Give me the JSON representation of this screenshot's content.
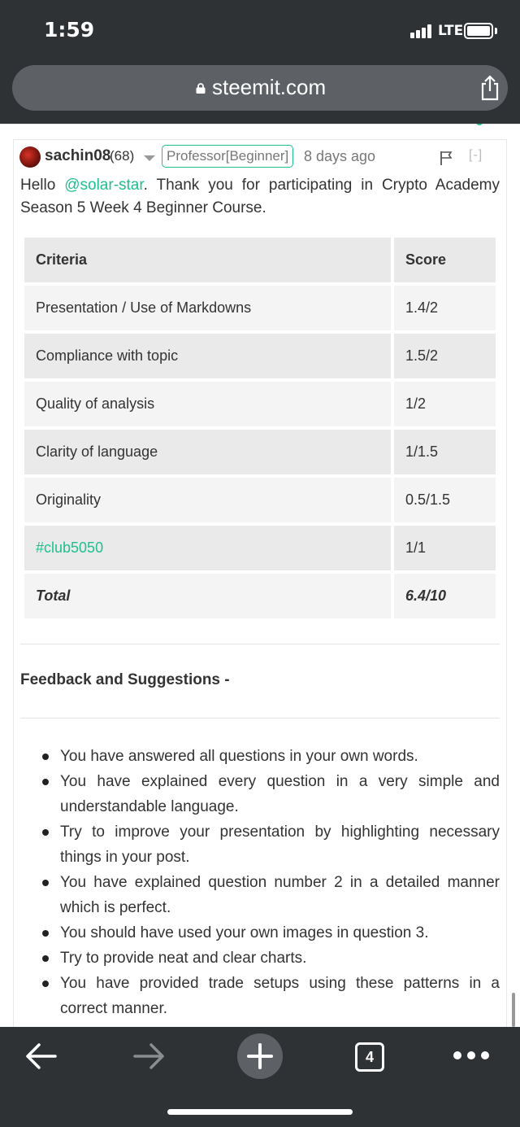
{
  "status_bar": {
    "time": "1:59",
    "network": "LTE"
  },
  "browser": {
    "url": "steemit.com"
  },
  "comment": {
    "author": "sachin08",
    "reputation": "(68)",
    "role_badge": "Professor[Beginner]",
    "timestamp": "8 days ago",
    "collapse": "[-]",
    "intro_greeting": "Hello ",
    "intro_mention": "@solar-star",
    "intro_rest": ". Thank you for participating in Crypto Academy Season 5 Week 4 Beginner Course.",
    "table": {
      "headers": [
        "Criteria",
        "Score"
      ],
      "rows": [
        {
          "criteria": "Presentation / Use of Markdowns",
          "score": "1.4/2"
        },
        {
          "criteria": "Compliance with topic",
          "score": "1.5/2"
        },
        {
          "criteria": "Quality of analysis",
          "score": "1/2"
        },
        {
          "criteria": "Clarity of language",
          "score": "1/1.5"
        },
        {
          "criteria": "Originality",
          "score": "0.5/1.5"
        },
        {
          "criteria": "#club5050",
          "score": "1/1"
        },
        {
          "criteria": "Total",
          "score": "6.4/10"
        }
      ]
    },
    "feedback_heading": "Feedback and Suggestions -",
    "feedback_items": [
      "You have answered all questions in your own words.",
      "You have explained every question in a very simple and understandable language.",
      "Try to improve your presentation by highlighting necessary things in your post.",
      "You have explained question number 2 in a detailed manner which is perfect.",
      "You should have used your own images in question 3.",
      "Try to provide neat and clear charts.",
      "You have provided trade setups using these patterns in a correct manner."
    ]
  },
  "toolbar": {
    "tab_count": "4"
  },
  "icons": {
    "lock": "lock-icon",
    "share": "share-icon",
    "flag": "flag-icon",
    "back": "back-arrow-icon",
    "forward": "forward-arrow-icon",
    "new_tab": "plus-icon",
    "tabs": "tabs-icon",
    "more": "more-icon"
  },
  "colors": {
    "accent": "#1fbf8f",
    "chrome": "#2f3235",
    "url_bar": "#5d6165"
  }
}
